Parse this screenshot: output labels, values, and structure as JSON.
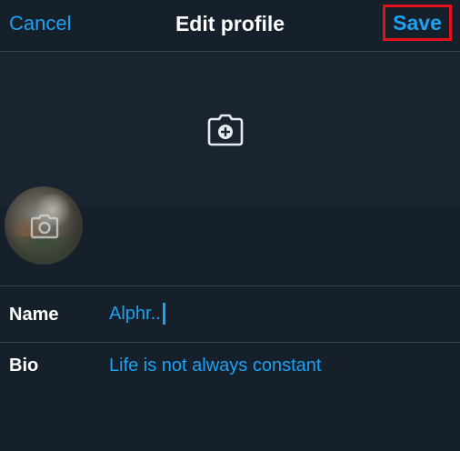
{
  "header": {
    "cancel_label": "Cancel",
    "title": "Edit profile",
    "save_label": "Save"
  },
  "banner": {
    "icon": "camera-plus-icon"
  },
  "avatar": {
    "icon": "camera-icon"
  },
  "fields": {
    "name": {
      "label": "Name",
      "value": "Alphr.."
    },
    "bio": {
      "label": "Bio",
      "value": "Life is not always constant"
    }
  },
  "colors": {
    "background": "#15202b",
    "accent": "#1da1f2",
    "divider": "#38444d",
    "highlight": "#e2121d"
  }
}
